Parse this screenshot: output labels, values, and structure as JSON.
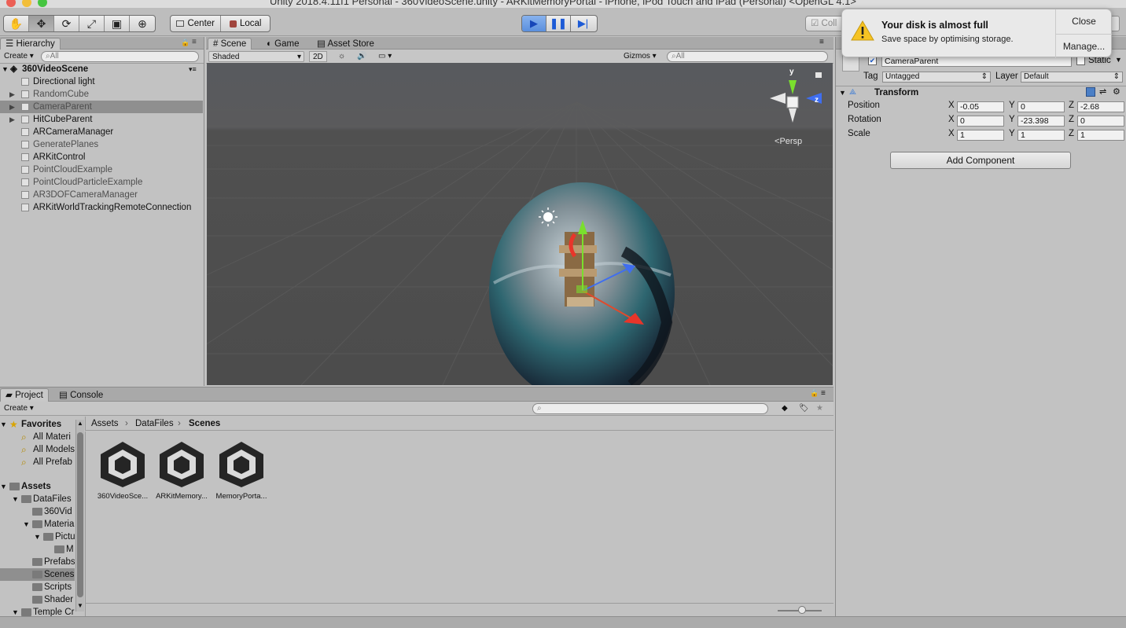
{
  "window_title": "Unity 2018.4.11f1 Personal - 360VideoScene.unity - ARKitMemoryPortal - iPhone, iPod Touch and iPad (Personal) <OpenGL 4.1>",
  "toolbar": {
    "tools": [
      "hand-icon",
      "move-icon",
      "rotate-icon",
      "scale-icon",
      "rect-icon",
      "transform-icon"
    ],
    "pivot_mode": "Center",
    "pivot_space": "Local",
    "collab": "Coll"
  },
  "notification": {
    "title": "Your disk is almost full",
    "message": "Save space by optimising storage.",
    "close": "Close",
    "manage": "Manage..."
  },
  "hierarchy": {
    "tab": "Hierarchy",
    "create": "Create",
    "search_placeholder": "All",
    "scene": "360VideoScene",
    "items": [
      {
        "label": "Directional light",
        "expandable": false,
        "selected": false,
        "enabled": true
      },
      {
        "label": "RandomCube",
        "expandable": true,
        "selected": false,
        "enabled": false
      },
      {
        "label": "CameraParent",
        "expandable": true,
        "selected": true,
        "enabled": false
      },
      {
        "label": "HitCubeParent",
        "expandable": true,
        "selected": false,
        "enabled": true
      },
      {
        "label": "ARCameraManager",
        "expandable": false,
        "selected": false,
        "enabled": true
      },
      {
        "label": "GeneratePlanes",
        "expandable": false,
        "selected": false,
        "enabled": false
      },
      {
        "label": "ARKitControl",
        "expandable": false,
        "selected": false,
        "enabled": true
      },
      {
        "label": "PointCloudExample",
        "expandable": false,
        "selected": false,
        "enabled": false
      },
      {
        "label": "PointCloudParticleExample",
        "expandable": false,
        "selected": false,
        "enabled": false
      },
      {
        "label": "AR3DOFCameraManager",
        "expandable": false,
        "selected": false,
        "enabled": false
      },
      {
        "label": "ARKitWorldTrackingRemoteConnection",
        "expandable": false,
        "selected": false,
        "enabled": true
      }
    ]
  },
  "scene_view": {
    "tabs": [
      "Scene",
      "Game",
      "Asset Store"
    ],
    "active_tab": "Scene",
    "draw_mode": "Shaded",
    "mode_2d": "2D",
    "gizmos": "Gizmos",
    "search_placeholder": "All",
    "projection": "Persp",
    "gizmo_axes": {
      "y": "y",
      "z": "z"
    }
  },
  "inspector": {
    "object_name": "CameraParent",
    "static_label": "Static",
    "tag_label": "Tag",
    "tag_value": "Untagged",
    "layer_label": "Layer",
    "layer_value": "Default",
    "transform": {
      "title": "Transform",
      "rows": [
        {
          "label": "Position",
          "x": "-0.05",
          "y": "0",
          "z": "-2.68"
        },
        {
          "label": "Rotation",
          "x": "0",
          "y": "-23.398",
          "z": "0"
        },
        {
          "label": "Scale",
          "x": "1",
          "y": "1",
          "z": "1"
        }
      ],
      "axis_labels": [
        "X",
        "Y",
        "Z"
      ]
    },
    "add_component": "Add Component"
  },
  "project": {
    "tabs": [
      "Project",
      "Console"
    ],
    "create": "Create",
    "favorites": {
      "label": "Favorites",
      "items": [
        "All Materi",
        "All Models",
        "All Prefab"
      ]
    },
    "assets": {
      "label": "Assets",
      "tree": [
        {
          "label": "DataFiles",
          "level": 1,
          "expanded": true
        },
        {
          "label": "360Vid",
          "level": 2,
          "expanded": false
        },
        {
          "label": "Materia",
          "level": 2,
          "expanded": true
        },
        {
          "label": "Pictu",
          "level": 3,
          "expanded": true
        },
        {
          "label": "M",
          "level": 4,
          "expanded": false
        },
        {
          "label": "Prefabs",
          "level": 2,
          "expanded": false
        },
        {
          "label": "Scenes",
          "level": 2,
          "expanded": false,
          "selected": true
        },
        {
          "label": "Scripts",
          "level": 2,
          "expanded": false
        },
        {
          "label": "Shader",
          "level": 2,
          "expanded": false
        },
        {
          "label": "Temple Cr",
          "level": 1,
          "expanded": true
        }
      ]
    },
    "breadcrumb": [
      "Assets",
      "DataFiles",
      "Scenes"
    ],
    "files": [
      "360VideoSce...",
      "ARKitMemory...",
      "MemoryPorta..."
    ]
  }
}
